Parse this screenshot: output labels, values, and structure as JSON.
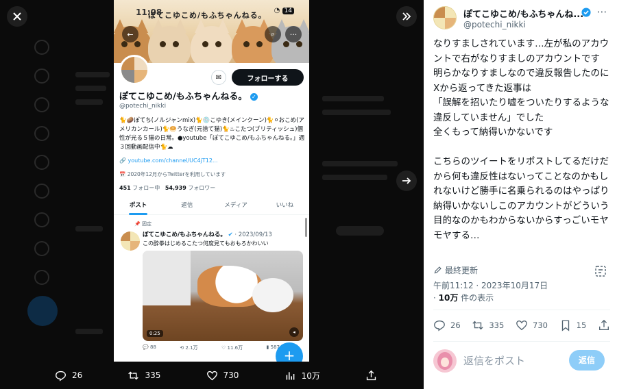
{
  "viewer": {
    "close_icon": "close-icon",
    "collapse_icon": "chevron-double-right-icon",
    "next_icon": "arrow-right-icon",
    "bottom_actions": [
      {
        "icon": "reply-icon",
        "count": "26"
      },
      {
        "icon": "retweet-icon",
        "count": "335"
      },
      {
        "icon": "heart-icon",
        "count": "730"
      },
      {
        "icon": "views-icon",
        "count": "10万"
      },
      {
        "icon": "share-icon",
        "count": ""
      }
    ]
  },
  "phone": {
    "status_time": "11:08",
    "banner_title": "ぽてこゆこめ/もふちゃんねる。",
    "battery": "14",
    "follow_button": "フォローする",
    "name": "ぽてこゆこめ/もふちゃんねる。",
    "handle": "@potechi_nikki",
    "bio": "🐈🥔ぽてち(ノルジャンmix)🐈💿こゆき(メインクーン)🐈⚪おこめ(アメリカンカール)🐈🥯うなぎ(元捨て猫)🐈♨こたつ(ブリティッシュ)個性が光る５猫の日常。●youtube「ぽてこゆこめ/もふちゃんねる。」週３回動画配信中🐈☁",
    "link": "youtube.com/channel/UC4jT12...",
    "joined": "2020年12月からTwitterを利用しています",
    "following_count": "451",
    "following_label": "フォロー中",
    "followers_count": "54,939",
    "followers_label": "フォロワー",
    "tabs": [
      "ポスト",
      "返信",
      "メディア",
      "いいね"
    ],
    "pinned_label": "固定",
    "tweet_name": "ぽてこゆこめ/もふちゃんねる。",
    "tweet_date": "· 2023/09/13",
    "tweet_text": "この酔拳はじめるこたつ何度見てもおもろかわいい",
    "video_duration": "0:25",
    "tweet_actions": [
      "88",
      "2.1万",
      "11.6万",
      "587"
    ]
  },
  "post": {
    "author_name": "ぽてこゆこめ/もふちゃんね...",
    "author_handle": "@potechi_nikki",
    "text": "なりすましされています…左が私のアカウントで右がなりすましのアカウントです\n明らかなりすましなので違反報告したのにXから返ってきた返事は\n「誤解を招いたり嘘をついたりするような違反していません」でした\n全くもって納得いかないです\n\nこちらのツイートをリポストしてるだけだから何も違反性はないってことなのかもしれないけど勝手に名乗られるのはやっぱり納得いかないしこのアカウントがどういう目的なのかもわからないからすっごいモヤモヤする…",
    "edited_label": "最終更新",
    "timestamp": "午前11:12 · 2023年10月17日",
    "views_count": "10万",
    "views_label": "件の表示",
    "actions": {
      "reply": "26",
      "retweet": "335",
      "like": "730",
      "bookmark": "15"
    },
    "reply_placeholder": "返信をポスト",
    "reply_button": "返信"
  },
  "colors": {
    "accent": "#1d9bf0",
    "reply_button_disabled": "#8ecdf8",
    "viewer_bg": "#0b0b0b"
  }
}
